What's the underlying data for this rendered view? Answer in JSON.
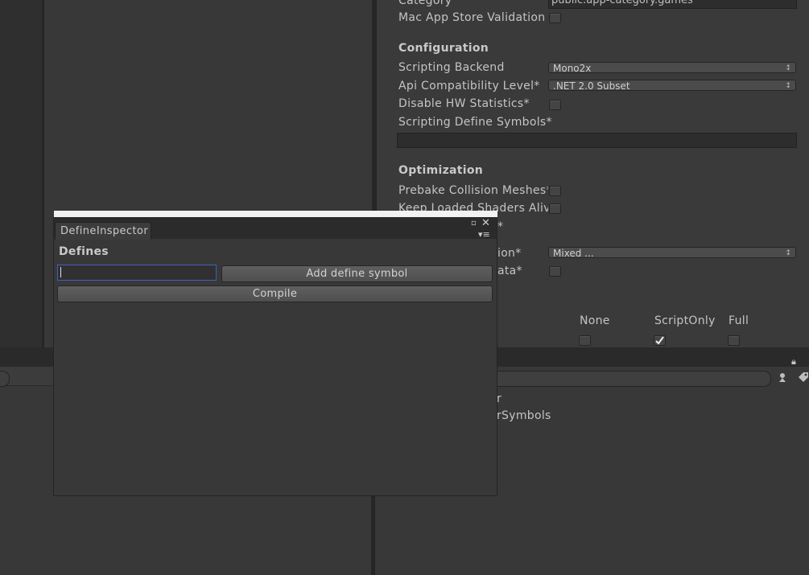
{
  "inspector": {
    "category_label": "Category",
    "category_value": "public.app-category.games",
    "mac_validation_label": "Mac App Store Validation",
    "configuration_header": "Configuration",
    "scripting_backend_label": "Scripting Backend",
    "scripting_backend_value": "Mono2x",
    "api_compat_label": "Api Compatibility Level*",
    "api_compat_value": ".NET 2.0 Subset",
    "disable_hw_label": "Disable HW Statistics*",
    "define_symbols_label": "Scripting Define Symbols*",
    "define_symbols_value": "",
    "optimization_header": "Optimization",
    "prebake_label": "Prebake Collision Meshes*",
    "keep_shaders_label": "Keep Loaded Shaders Alive*",
    "star_fragment": "*",
    "stripping_fragment": "ion*",
    "stripping_value": "Mixed ...",
    "data_fragment": "ata*",
    "log_col_none": "None",
    "log_col_scriptonly": "ScriptOnly",
    "log_col_full": "Full"
  },
  "project": {
    "item_1": "r",
    "item_2": "rSymbols"
  },
  "define_window": {
    "tab_title": "DefineInspector",
    "section_header": "Defines",
    "input_value": "",
    "add_button": "Add define symbol",
    "compile_button": "Compile"
  },
  "icons": {
    "maximize": "maximize-icon",
    "close": "close-icon",
    "menu": "context-menu-icon",
    "dropdown": "dropdown-arrow-icon",
    "check": "checkmark-icon",
    "lock": "lock-icon",
    "tag": "tag-icon",
    "filter": "filter-icon"
  },
  "colors": {
    "background": "#383838",
    "focus_outline": "#3f5fbf",
    "title_line": "#f2f2f2"
  }
}
